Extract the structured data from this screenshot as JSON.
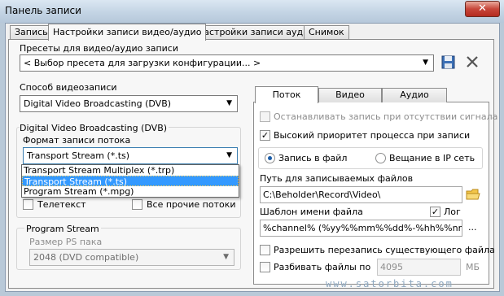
{
  "window": {
    "title": "Панель записи",
    "close": "✕"
  },
  "tabs": [
    {
      "label": "Запись"
    },
    {
      "label": "Настройки записи видео/аудио"
    },
    {
      "label": "Настройки записи аудио"
    },
    {
      "label": "Снимок"
    }
  ],
  "presets": {
    "label": "Пресеты для видео/аудио записи",
    "value": "< Выбор пресета для загрузки конфигурации... >"
  },
  "video_method": {
    "label": "Способ видеозаписи",
    "value": "Digital Video Broadcasting (DVB)"
  },
  "dvb_group": {
    "title": "Digital Video Broadcasting (DVB)",
    "format_label": "Формат записи потока",
    "format_value": "Transport Stream (*.ts)",
    "format_options": [
      "Transport Stream Multiplex (*.trp)",
      "Transport Stream (*.ts)",
      "Program Stream (*.mpg)"
    ],
    "teletext": "Телетекст",
    "all_other_streams": "Все прочие потоки"
  },
  "program_stream": {
    "title": "Program Stream",
    "packet_size_label": "Размер PS пака",
    "packet_size_value": "2048 (DVD compatible)"
  },
  "right_tabs": [
    {
      "label": "Поток"
    },
    {
      "label": "Видео"
    },
    {
      "label": "Аудио"
    }
  ],
  "stream": {
    "stop_on_no_signal": "Останавливать запись при отсутствии сигнала",
    "high_priority": "Высокий приоритет процесса при записи",
    "record_to_file": "Запись в файл",
    "ip_broadcast": "Вещание в IP сеть",
    "path_label": "Путь для записываемых файлов",
    "path_value": "C:\\Beholder\\Record\\Video\\",
    "template_label": "Шаблон имени файла",
    "log_label": "Лог",
    "template_value": "%channel% (%yy%%mm%%dd%-%hh%%nn%",
    "browse": "...",
    "allow_overwrite": "Разрешить перезапись существующего файла",
    "split_files": "Разбивать файлы по",
    "split_value": "4095",
    "split_unit": "МБ"
  },
  "watermark": "www.satorbita.com"
}
